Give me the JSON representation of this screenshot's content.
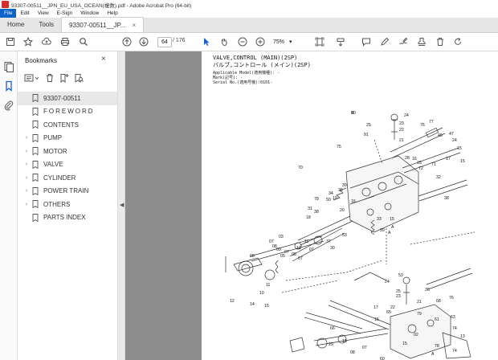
{
  "window": {
    "title": "93307-00511__JPN_EU_USA_OCEAN(複数).pdf - Adobe Acrobat Pro (64-bit)"
  },
  "menu": [
    "File",
    "Edit",
    "View",
    "E-Sign",
    "Window",
    "Help"
  ],
  "tabs": {
    "home": "Home",
    "tools": "Tools",
    "document": "93307-00511__JP...",
    "close_glyph": "×"
  },
  "toolbar": {
    "current_page": "64",
    "total_pages": "/ 176",
    "zoom": "75%",
    "zoom_caret": "▾"
  },
  "panel": {
    "title": "Bookmarks",
    "close_glyph": "×",
    "bookmarks": [
      {
        "label": "93307-00511",
        "expandable": false,
        "selected": true
      },
      {
        "label": "FOREWORD",
        "expandable": false,
        "selected": false
      },
      {
        "label": "CONTENTS",
        "expandable": false,
        "selected": false
      },
      {
        "label": "PUMP",
        "expandable": true,
        "selected": false
      },
      {
        "label": "MOTOR",
        "expandable": true,
        "selected": false
      },
      {
        "label": "VALVE",
        "expandable": true,
        "selected": false
      },
      {
        "label": "CYLINDER",
        "expandable": true,
        "selected": false
      },
      {
        "label": "POWER TRAIN",
        "expandable": true,
        "selected": false
      },
      {
        "label": "OTHERS",
        "expandable": true,
        "selected": false
      },
      {
        "label": "PARTS INDEX",
        "expandable": false,
        "selected": false
      }
    ]
  },
  "page": {
    "heading_en": "VALVE,CONTROL (MAIN)(2SP)",
    "heading_jp": "バルブ,コントロール (メイン)(2SP)",
    "applicable_model": "Applicable Model(適用機種): -",
    "mark": "Mark(記号): -",
    "serial_no": "Serial No.(適用号機):0101-",
    "callouts": [
      "90",
      "24",
      "25",
      "23",
      "22",
      "91",
      "21",
      "77",
      "76",
      "75",
      "45",
      "28",
      "47",
      "24",
      "15",
      "17",
      "15",
      "16",
      "15",
      "72",
      "71",
      "70",
      "78",
      "50",
      "19",
      "34",
      "36",
      "39",
      "32",
      "31",
      "38",
      "18",
      "20",
      "16",
      "38",
      "33",
      "15",
      "39",
      "A",
      "A",
      "53",
      "03",
      "07",
      "11",
      "08",
      "09",
      "07",
      "10",
      "05",
      "07",
      "08",
      "12",
      "14",
      "15",
      "10",
      "11",
      "08",
      "07",
      "37",
      "30",
      "53",
      "24",
      "25",
      "23",
      "22",
      "36",
      "21",
      "76",
      "17",
      "65",
      "79",
      "02",
      "15",
      "66",
      "29",
      "08",
      "07",
      "15",
      "78",
      "74",
      "74",
      "13",
      "60",
      "A",
      "63",
      "61",
      "68",
      "15",
      "B"
    ]
  }
}
